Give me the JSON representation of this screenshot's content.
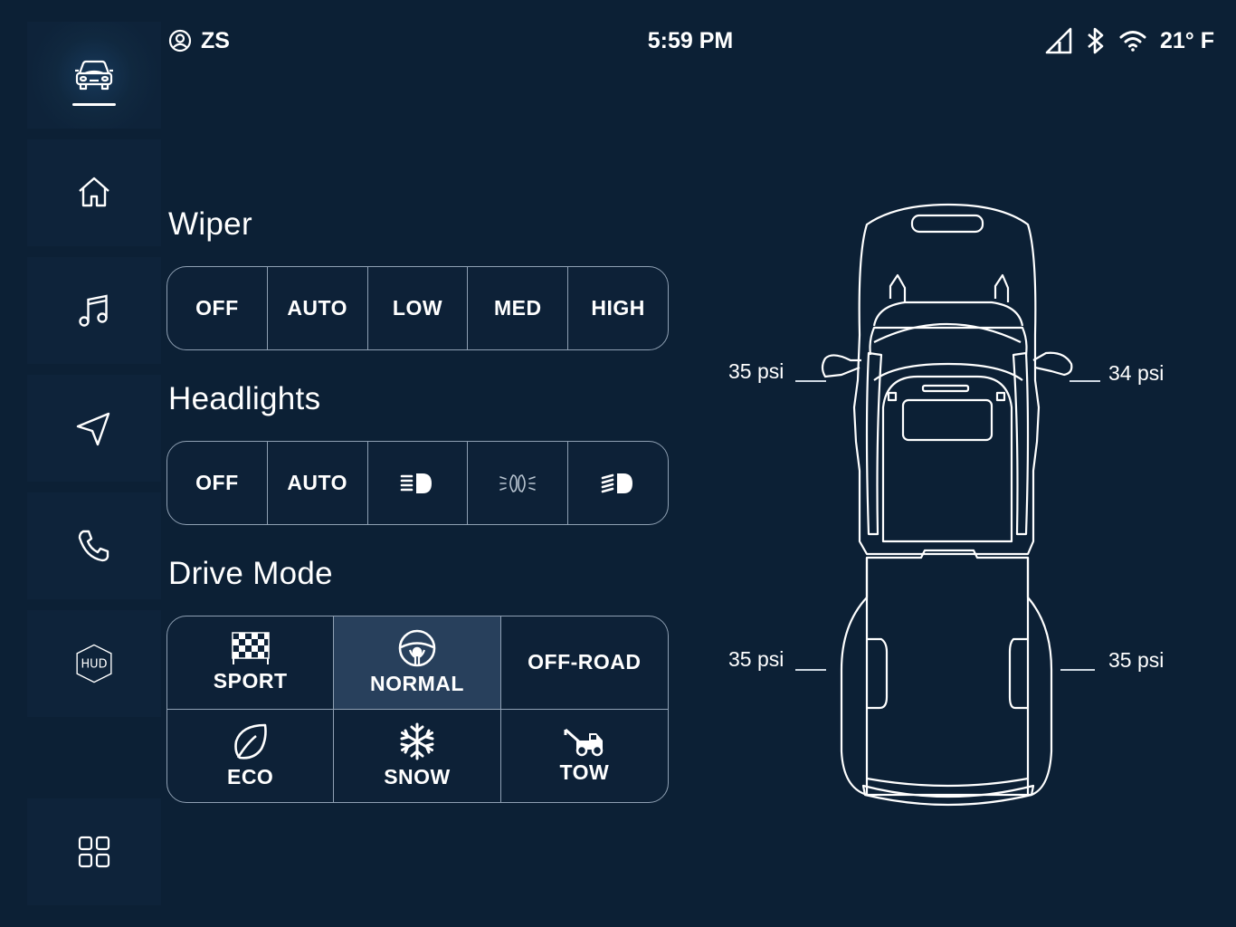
{
  "status": {
    "user": "ZS",
    "time": "5:59 PM",
    "temperature": "21° F"
  },
  "sidebar": {
    "items": [
      {
        "icon": "car-icon",
        "active": true
      },
      {
        "icon": "home-icon",
        "active": false
      },
      {
        "icon": "music-note-icon",
        "active": false
      },
      {
        "icon": "navigation-arrow-icon",
        "active": false
      },
      {
        "icon": "phone-icon",
        "active": false
      },
      {
        "icon": "hud-icon",
        "label": "HUD",
        "active": false
      },
      {
        "icon": "app-grid-icon",
        "active": false
      }
    ]
  },
  "wiper": {
    "title": "Wiper",
    "options": [
      "OFF",
      "AUTO",
      "LOW",
      "MED",
      "HIGH"
    ]
  },
  "headlights": {
    "title": "Headlights",
    "options": [
      {
        "label": "OFF"
      },
      {
        "label": "AUTO"
      },
      {
        "icon": "low-beam-icon"
      },
      {
        "icon": "parking-lights-icon"
      },
      {
        "icon": "high-beam-icon"
      }
    ]
  },
  "drive_mode": {
    "title": "Drive Mode",
    "selected": "NORMAL",
    "modes": [
      {
        "label": "SPORT",
        "icon": "checkered-flag-icon"
      },
      {
        "label": "NORMAL",
        "icon": "steering-wheel-icon"
      },
      {
        "label": "OFF-ROAD"
      },
      {
        "label": "ECO",
        "icon": "leaf-icon"
      },
      {
        "label": "SNOW",
        "icon": "snowflake-icon"
      },
      {
        "label": "TOW",
        "icon": "tow-truck-icon"
      }
    ]
  },
  "tires": {
    "front_left": "35 psi",
    "front_right": "34 psi",
    "rear_left": "35 psi",
    "rear_right": "35 psi"
  },
  "colors": {
    "background": "#0c2035",
    "panel": "#0e233a",
    "selected": "#28405c",
    "border": "#8fa0b3"
  }
}
